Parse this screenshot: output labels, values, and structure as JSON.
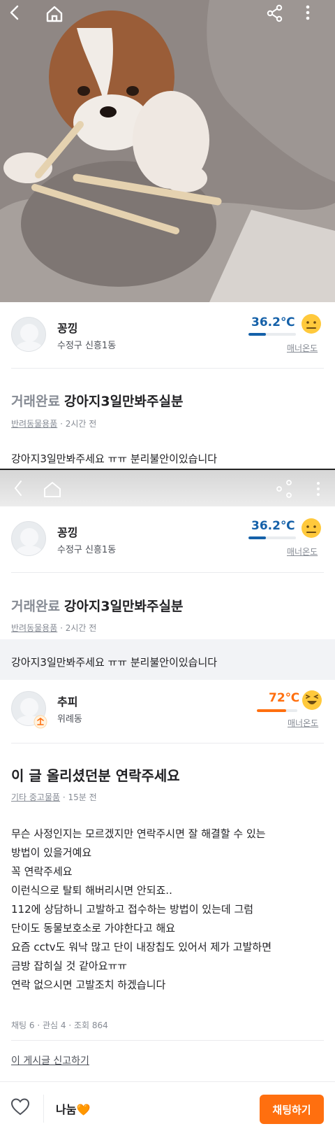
{
  "topbar": {
    "icons": [
      "back-icon",
      "home-icon",
      "share-icon",
      "more-vertical-icon"
    ]
  },
  "seller_card": {
    "nickname": "꽁낑",
    "region": "수정구 신흥1동",
    "temperature": "36.2℃",
    "temperature_value": 36.2,
    "manner_label": "매너온도",
    "temp_color": "#1561a9"
  },
  "post": {
    "status": "거래완료",
    "title": "강아지3일만봐주실분",
    "category": "반려동물용품",
    "time": "2시간 전",
    "body": "강아지3일만봐주세요 ㅠㅠ 분리불안이있습니다"
  },
  "comment_card": {
    "nickname": "추피",
    "region": "위례동",
    "temperature": "72℃",
    "temperature_value": 72,
    "manner_label": "매너온도",
    "temp_color": "#ff6f0f"
  },
  "comment_post": {
    "title": "이 글 올리셨던분 연락주세요",
    "category": "기타 중고물품",
    "time": "15분 전",
    "lines": [
      "무슨 사정인지는 모르겠지만 연락주시면 잘 해결할 수 있는",
      "방법이 있을거예요",
      "꼭 연락주세요",
      "이런식으로 탈퇴 해버리시면 안되죠..",
      "112에 상담하니 고발하고 접수하는 방법이 있는데 그럼",
      "단이도 동물보호소로 가야한다고 해요",
      "요즘 cctv도 워낙 많고 단이 내장칩도 있어서 제가 고발하면",
      "금방 잡히실 것 같아요ㅠㅠ",
      "연락 없으시면 고발조치 하겠습니다"
    ],
    "stats": "채팅 6 · 관심 4 · 조회 864",
    "report": "이 게시글 신고하기"
  },
  "bottom_bar": {
    "price": "나눔🧡",
    "chat_button": "채팅하기"
  },
  "colors": {
    "accent": "#ff6f0f",
    "cool_temp": "#1561a9"
  }
}
